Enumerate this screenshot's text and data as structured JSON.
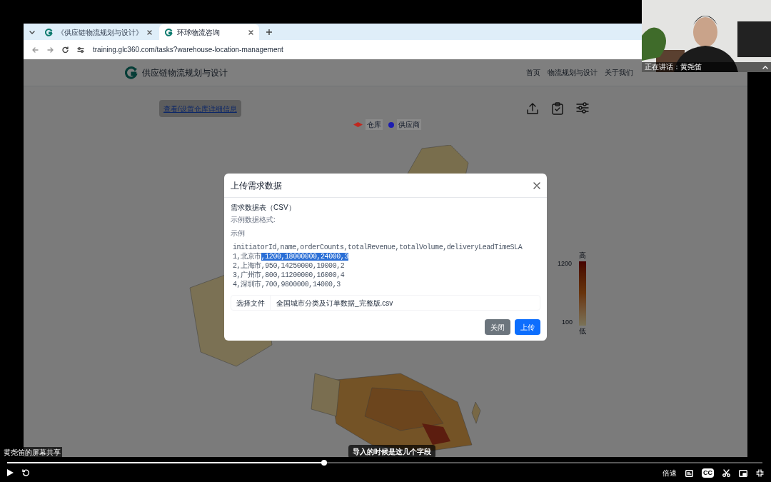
{
  "browser": {
    "tabs": [
      {
        "title": "《供应链物流规划与设计》",
        "selected": false
      },
      {
        "title": "环球物流咨询",
        "selected": true
      }
    ],
    "address": "training.glc360.com/tasks?warehouse-location-management"
  },
  "site": {
    "title": "供应链物流规划与设计",
    "nav": [
      "首页",
      "物流规划与设计",
      "关于我们"
    ],
    "action_button": "查看/设置仓库详细信息",
    "legend": [
      {
        "label": "仓库",
        "kind": "diamond",
        "color": "#c0281f"
      },
      {
        "label": "供应商",
        "kind": "circle",
        "color": "#1c1cb0"
      }
    ],
    "scale": {
      "top_label": "高",
      "max": "1200",
      "min": "100",
      "bottom_label": "低"
    }
  },
  "dialog": {
    "title": "上传需求数据",
    "field_label": "需求数据表（CSV）",
    "format_label": "示例数据格式:",
    "example_label": "示例",
    "code_lines": [
      {
        "segments": [
          {
            "text": "initiatorId,name,orderCounts,totalRevenue,totalVolume,deliveryLeadTimeSLA",
            "selected": false
          }
        ]
      },
      {
        "segments": [
          {
            "text": "1,北京市",
            "selected": false
          },
          {
            "text": ",1200,18000000,24000,3",
            "selected": true
          }
        ]
      },
      {
        "segments": [
          {
            "text": "2,上海市,950,14250000,19000,2",
            "selected": false
          }
        ]
      },
      {
        "segments": [
          {
            "text": "3,广州市,800,11200000,16000,4",
            "selected": false
          }
        ]
      },
      {
        "segments": [
          {
            "text": "4,深圳市,700,9800000,14000,3",
            "selected": false
          }
        ]
      }
    ],
    "file_button": "选择文件",
    "file_name": "全国城市分类及订单数据_完整版.csv",
    "buttons": [
      {
        "label": "关闭",
        "kind": "secondary"
      },
      {
        "label": "上传",
        "kind": "primary"
      }
    ]
  },
  "meeting": {
    "speaker": "正在讲话：黄尧笛",
    "share_label": "黄尧笛的屏幕共享",
    "subtitle": "导入的时候是这几个字段"
  },
  "player": {
    "progress": {
      "level": 0.42
    },
    "speed": "倍速",
    "captions": "CC"
  }
}
